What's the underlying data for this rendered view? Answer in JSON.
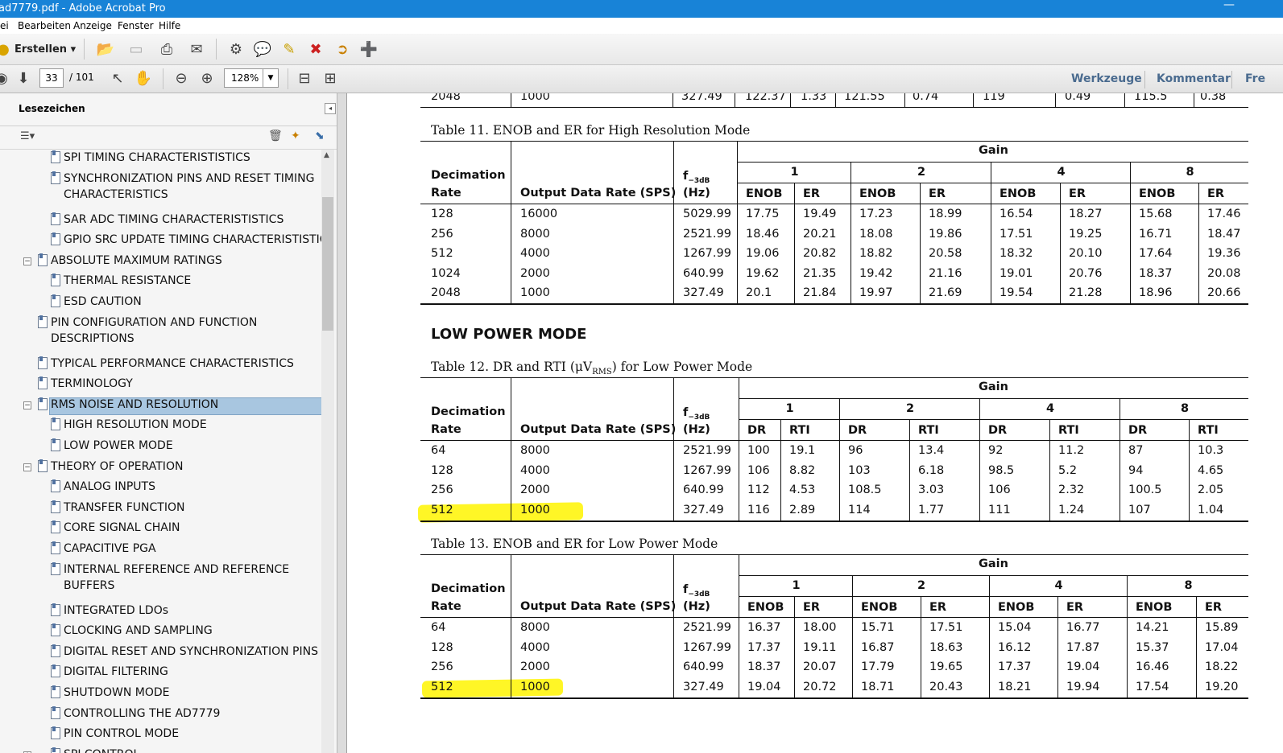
{
  "window": {
    "title": "ad7779.pdf - Adobe Acrobat Pro"
  },
  "menu": [
    "ei",
    "Bearbeiten",
    "Anzeige",
    "Fenster",
    "Hilfe"
  ],
  "toolbar": {
    "create_label": "Erstellen",
    "page_current": "33",
    "page_total": "/ 101",
    "zoom": "128%"
  },
  "panels": {
    "tools": "Werkzeuge",
    "comment": "Kommentar",
    "share": "Fre"
  },
  "sidebar": {
    "title": "Lesezeichen",
    "items": [
      {
        "label": "SPI TIMING CHARACTERISTISTICS",
        "level": 2
      },
      {
        "label": "SYNCHRONIZATION PINS AND RESET TIMING",
        "label2": "CHARACTERISTICS",
        "level": 2
      },
      {
        "label": "SAR ADC TIMING CHARACTERISTISTICS",
        "level": 2
      },
      {
        "label": "GPIO SRC UPDATE TIMING CHARACTERISTISTICS",
        "level": 2
      },
      {
        "label": "ABSOLUTE MAXIMUM RATINGS",
        "level": 1,
        "expander": "−"
      },
      {
        "label": "THERMAL RESISTANCE",
        "level": 2
      },
      {
        "label": "ESD CAUTION",
        "level": 2
      },
      {
        "label": "PIN CONFIGURATION AND FUNCTION",
        "label2": "DESCRIPTIONS",
        "level": 1
      },
      {
        "label": "TYPICAL PERFORMANCE CHARACTERISTICS",
        "level": 1
      },
      {
        "label": "TERMINOLOGY",
        "level": 1
      },
      {
        "label": "RMS NOISE AND RESOLUTION",
        "level": 1,
        "expander": "−",
        "selected": true
      },
      {
        "label": "HIGH RESOLUTION MODE",
        "level": 2
      },
      {
        "label": "LOW POWER MODE",
        "level": 2
      },
      {
        "label": "THEORY OF OPERATION",
        "level": 1,
        "expander": "−"
      },
      {
        "label": "ANALOG INPUTS",
        "level": 2
      },
      {
        "label": "TRANSFER FUNCTION",
        "level": 2
      },
      {
        "label": "CORE SIGNAL CHAIN",
        "level": 2
      },
      {
        "label": "CAPACITIVE PGA",
        "level": 2
      },
      {
        "label": "INTERNAL REFERENCE AND REFERENCE",
        "label2": "BUFFERS",
        "level": 2
      },
      {
        "label": "INTEGRATED LDOs",
        "level": 2
      },
      {
        "label": "CLOCKING AND SAMPLING",
        "level": 2
      },
      {
        "label": "DIGITAL RESET AND SYNCHRONIZATION PINS",
        "level": 2
      },
      {
        "label": "DIGITAL FILTERING",
        "level": 2
      },
      {
        "label": "SHUTDOWN MODE",
        "level": 2
      },
      {
        "label": "CONTROLLING THE AD7779",
        "level": 2
      },
      {
        "label": "PIN CONTROL MODE",
        "level": 2
      },
      {
        "label": "SPI CONTROL",
        "level": 2,
        "expander": "+"
      }
    ]
  },
  "doc": {
    "prev_row": [
      "2048",
      "1000",
      "327.49",
      "122.37",
      "1.33",
      "121.55",
      "0.74",
      "119",
      "0.49",
      "115.5",
      "0.38"
    ],
    "table11": {
      "caption": "Table 11. ENOB and ER for High Resolution Mode",
      "gain_label": "Gain",
      "col_dec1": "Decimation",
      "col_dec2": "Rate",
      "col_odr": "Output Data Rate (SPS)",
      "col_f1": "f",
      "col_fsub": "−3dB",
      "col_f2": "(Hz)",
      "gains": [
        "1",
        "2",
        "4",
        "8"
      ],
      "sub": [
        "ENOB",
        "ER"
      ],
      "rows": [
        [
          "128",
          "16000",
          "5029.99",
          "17.75",
          "19.49",
          "17.23",
          "18.99",
          "16.54",
          "18.27",
          "15.68",
          "17.46"
        ],
        [
          "256",
          "8000",
          "2521.99",
          "18.46",
          "20.21",
          "18.08",
          "19.86",
          "17.51",
          "19.25",
          "16.71",
          "18.47"
        ],
        [
          "512",
          "4000",
          "1267.99",
          "19.06",
          "20.82",
          "18.82",
          "20.58",
          "18.32",
          "20.10",
          "17.64",
          "19.36"
        ],
        [
          "1024",
          "2000",
          "640.99",
          "19.62",
          "21.35",
          "19.42",
          "21.16",
          "19.01",
          "20.76",
          "18.37",
          "20.08"
        ],
        [
          "2048",
          "1000",
          "327.49",
          "20.1",
          "21.84",
          "19.97",
          "21.69",
          "19.54",
          "21.28",
          "18.96",
          "20.66"
        ]
      ]
    },
    "section": "LOW POWER MODE",
    "table12": {
      "caption_pre": "Table 12. DR and RTI (μV",
      "caption_sub": "RMS",
      "caption_post": ") for Low Power Mode",
      "gain_label": "Gain",
      "col_dec1": "Decimation",
      "col_dec2": "Rate",
      "col_odr": "Output Data Rate (SPS)",
      "col_f1": "f",
      "col_fsub": "−3dB",
      "col_f2": "(Hz)",
      "gains": [
        "1",
        "2",
        "4",
        "8"
      ],
      "sub": [
        "DR",
        "RTI"
      ],
      "rows": [
        [
          "64",
          "8000",
          "2521.99",
          "100",
          "19.1",
          "96",
          "13.4",
          "92",
          "11.2",
          "87",
          "10.3"
        ],
        [
          "128",
          "4000",
          "1267.99",
          "106",
          "8.82",
          "103",
          "6.18",
          "98.5",
          "5.2",
          "94",
          "4.65"
        ],
        [
          "256",
          "2000",
          "640.99",
          "112",
          "4.53",
          "108.5",
          "3.03",
          "106",
          "2.32",
          "100.5",
          "2.05"
        ],
        [
          "512",
          "1000",
          "327.49",
          "116",
          "2.89",
          "114",
          "1.77",
          "111",
          "1.24",
          "107",
          "1.04"
        ]
      ]
    },
    "table13": {
      "caption": "Table 13. ENOB and ER for Low Power Mode",
      "gain_label": "Gain",
      "col_dec1": "Decimation",
      "col_dec2": "Rate",
      "col_odr": "Output Data Rate (SPS)",
      "col_f1": "f",
      "col_fsub": "−3dB",
      "col_f2": "(Hz)",
      "gains": [
        "1",
        "2",
        "4",
        "8"
      ],
      "sub": [
        "ENOB",
        "ER"
      ],
      "rows": [
        [
          "64",
          "8000",
          "2521.99",
          "16.37",
          "18.00",
          "15.71",
          "17.51",
          "15.04",
          "16.77",
          "14.21",
          "15.89"
        ],
        [
          "128",
          "4000",
          "1267.99",
          "17.37",
          "19.11",
          "16.87",
          "18.63",
          "16.12",
          "17.87",
          "15.37",
          "17.04"
        ],
        [
          "256",
          "2000",
          "640.99",
          "18.37",
          "20.07",
          "17.79",
          "19.65",
          "17.37",
          "19.04",
          "16.46",
          "18.22"
        ],
        [
          "512",
          "1000",
          "327.49",
          "19.04",
          "20.72",
          "18.71",
          "20.43",
          "18.21",
          "19.94",
          "17.54",
          "19.20"
        ]
      ]
    },
    "highlight_color": "#fff500"
  }
}
